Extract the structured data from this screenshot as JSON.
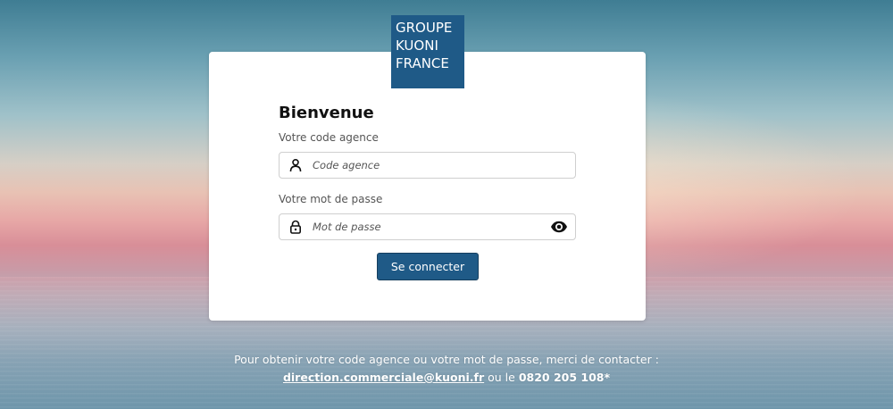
{
  "logo": {
    "lines": [
      "GROUPE",
      "KUONI",
      "FRANCE"
    ],
    "color": "#1f5a87"
  },
  "login": {
    "title": "Bienvenue",
    "agency_code": {
      "label": "Votre code agence",
      "placeholder": "Code agence",
      "value": "",
      "icon": "user-icon"
    },
    "password": {
      "label": "Votre mot de passe",
      "placeholder": "Mot de passe",
      "value": "",
      "icon": "lock-icon",
      "toggle_icon": "eye-icon"
    },
    "submit_label": "Se connecter",
    "button_color": "#1f5a87"
  },
  "footer": {
    "line1": "Pour obtenir votre code agence ou votre mot de passe, merci de contacter :",
    "email": "direction.commerciale@kuoni.fr",
    "connector": " ou le ",
    "phone": "0820 205 108*"
  }
}
